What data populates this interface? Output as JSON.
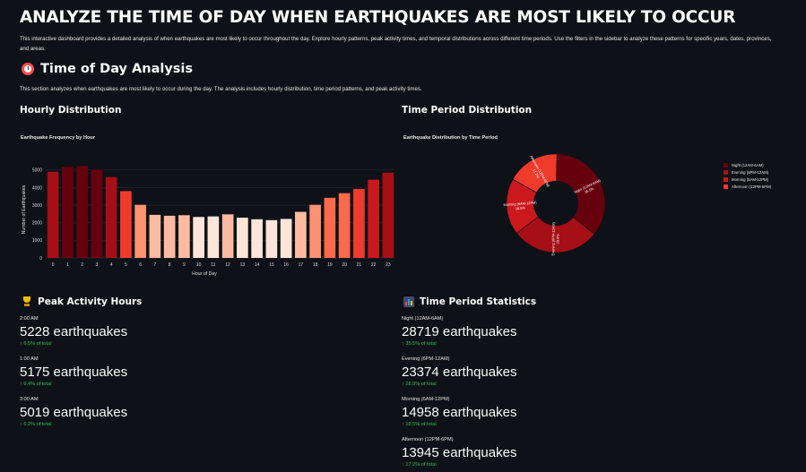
{
  "header": {
    "title": "ANALYZE THE TIME OF DAY WHEN EARTHQUAKES ARE MOST LIKELY TO OCCUR",
    "intro": "This interactive dashboard provides a detailed analysis of when earthquakes are most likely to occur throughout the day. Explore hourly patterns, peak activity times, and temporal distributions across different time periods. Use the filters in the sidebar to analyze these patterns for specific years, dates, provinces, and areas."
  },
  "section": {
    "icon": "alarm-clock-icon",
    "title": "Time of Day Analysis",
    "description": "This section analyzes when earthquakes are most likely to occur during the day. The analysis includes hourly distribution, time period patterns, and peak activity times."
  },
  "hourly": {
    "heading": "Hourly Distribution",
    "chart_title": "Earthquake Frequency by Hour"
  },
  "period": {
    "heading": "Time Period Distribution",
    "chart_title": "Earthquake Distribution by Time Period"
  },
  "peak": {
    "icon": "trophy-icon",
    "heading": "Peak Activity Hours",
    "metrics": [
      {
        "label": "2:00 AM",
        "value": "5228 earthquakes",
        "delta": "6.5% of total"
      },
      {
        "label": "1:00 AM",
        "value": "5175 earthquakes",
        "delta": "6.4% of total"
      },
      {
        "label": "3:00 AM",
        "value": "5019 earthquakes",
        "delta": "6.2% of total"
      }
    ]
  },
  "stats": {
    "icon": "bar-chart-icon",
    "heading": "Time Period Statistics",
    "metrics": [
      {
        "label": "Night (12AM-6AM)",
        "value": "28719 earthquakes",
        "delta": "35.5% of total"
      },
      {
        "label": "Evening (6PM-12AM)",
        "value": "23374 earthquakes",
        "delta": "28.9% of total"
      },
      {
        "label": "Morning (6AM-12PM)",
        "value": "14958 earthquakes",
        "delta": "18.5% of total"
      },
      {
        "label": "Afternoon (12PM-6PM)",
        "value": "13945 earthquakes",
        "delta": "17.2% of total"
      }
    ]
  },
  "colors": {
    "background": "#0e1117",
    "delta_green": "#21c354",
    "bar_scale": [
      "#fee5d9",
      "#fcbba1",
      "#fc9272",
      "#fb6a4a",
      "#ef3b2c",
      "#cb181d",
      "#a50f15",
      "#67000d"
    ]
  },
  "chart_data": [
    {
      "type": "bar",
      "title": "Earthquake Frequency by Hour",
      "xlabel": "Hour of Day",
      "ylabel": "Number of Earthquakes",
      "categories": [
        "0",
        "1",
        "2",
        "3",
        "4",
        "5",
        "6",
        "7",
        "8",
        "9",
        "10",
        "11",
        "12",
        "13",
        "14",
        "15",
        "16",
        "17",
        "18",
        "19",
        "20",
        "21",
        "22",
        "23"
      ],
      "values": [
        4900,
        5175,
        5228,
        5019,
        4600,
        3800,
        3020,
        2450,
        2400,
        2430,
        2330,
        2360,
        2480,
        2290,
        2200,
        2150,
        2220,
        2620,
        3020,
        3420,
        3680,
        3920,
        4450,
        4850
      ],
      "ylim": [
        0,
        5500
      ],
      "yticks": [
        0,
        1000,
        2000,
        3000,
        4000,
        5000
      ],
      "grid": true
    },
    {
      "type": "pie",
      "title": "Earthquake Distribution by Time Period",
      "hole": 0.45,
      "labels": [
        "Night (12AM-6AM)",
        "Evening (6PM-12AM)",
        "Morning (6AM-12PM)",
        "Afternoon (12PM-6PM)"
      ],
      "values": [
        28719,
        23374,
        14958,
        13945
      ],
      "percent_labels": [
        "35.5%",
        "28.9%",
        "18.5%",
        "17.2%"
      ],
      "colors": [
        "#67000d",
        "#a50f15",
        "#cb181d",
        "#ef3b2c"
      ],
      "legend": "right"
    }
  ]
}
